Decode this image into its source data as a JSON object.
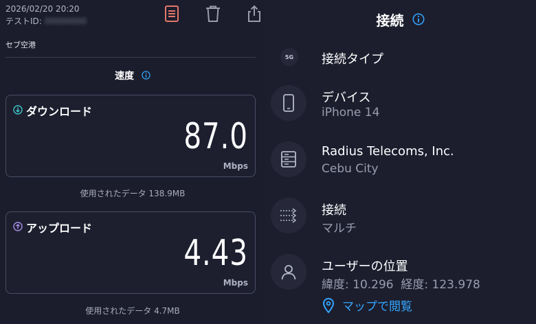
{
  "header": {
    "datetime": "2026/02/20 20:20",
    "test_id_label": "テストID:",
    "test_id_value": "00000000"
  },
  "toolbar": {
    "icons": [
      "document-icon",
      "trash-icon",
      "share-icon"
    ],
    "colors": {
      "document": "#e4776b",
      "default": "#9a9cab"
    }
  },
  "location": "セブ空港",
  "speed": {
    "title": "速度",
    "download": {
      "label": "ダウンロード",
      "value": "87.0",
      "unit": "Mbps",
      "used": "使用されたデータ 138.9MB",
      "color": "#3fc5c9"
    },
    "upload": {
      "label": "アップロード",
      "value": "4.43",
      "unit": "Mbps",
      "used": "使用されたデータ 4.7MB",
      "color": "#a88fe8"
    }
  },
  "connection": {
    "title": "接続",
    "type": {
      "badge": "5G",
      "title": "接続タイプ"
    },
    "device": {
      "title": "デバイス",
      "subtitle": "iPhone 14"
    },
    "provider": {
      "title": "Radius Telecoms, Inc.",
      "subtitle": "Cebu City"
    },
    "connections": {
      "title": "接続",
      "subtitle": "マルチ"
    },
    "user_location": {
      "title": "ユーザーの位置",
      "subtitle": "緯度: 10.296  経度: 123.978"
    },
    "map_link": "マップで閲覧",
    "accent": "#34a6ff"
  }
}
